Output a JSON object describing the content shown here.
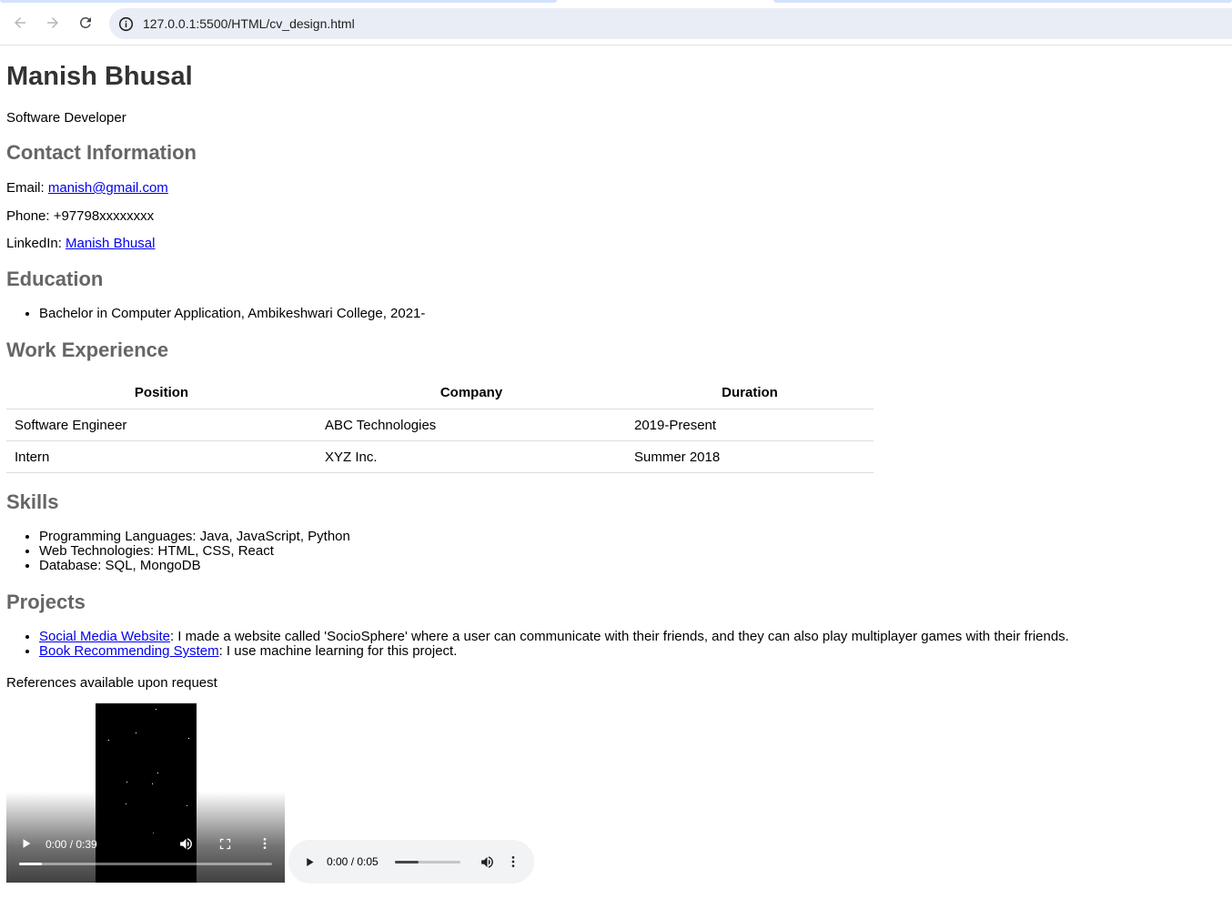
{
  "browser": {
    "url": "127.0.0.1:5500/HTML/cv_design.html",
    "icons": {
      "back": "arrow-left-icon",
      "forward": "arrow-right-icon",
      "reload": "reload-icon",
      "site_info": "info-icon"
    }
  },
  "cv": {
    "name": "Manish Bhusal",
    "title": "Software Developer",
    "contact": {
      "heading": "Contact Information",
      "email_label": "Email: ",
      "email": "manish@gmail.com",
      "phone": "Phone: +97798xxxxxxxx",
      "linkedin_label": "LinkedIn: ",
      "linkedin": "Manish Bhusal"
    },
    "education": {
      "heading": "Education",
      "items": [
        "Bachelor in Computer Application, Ambikeshwari College, 2021-"
      ]
    },
    "work": {
      "heading": "Work Experience",
      "columns": [
        "Position",
        "Company",
        "Duration"
      ],
      "rows": [
        [
          "Software Engineer",
          "ABC Technologies",
          "2019-Present"
        ],
        [
          "Intern",
          "XYZ Inc.",
          "Summer 2018"
        ]
      ]
    },
    "skills": {
      "heading": "Skills",
      "items": [
        "Programming Languages: Java, JavaScript, Python",
        "Web Technologies: HTML, CSS, React",
        "Database: SQL, MongoDB"
      ]
    },
    "projects": {
      "heading": "Projects",
      "items": [
        {
          "link": "Social Media Website",
          "text": ": I made a website called 'SocioSphere' where a user can communicate with their friends, and they can also play multiplayer games with their friends."
        },
        {
          "link": "Book Recommending System",
          "text": ": I use machine learning for this project."
        }
      ]
    },
    "references": "References available upon request"
  },
  "media": {
    "video": {
      "time": "0:00 / 0:39",
      "progress": 0.09
    },
    "audio": {
      "time": "0:00 / 0:05",
      "progress": 0.36
    }
  },
  "colors": {
    "heading": "#333333",
    "section_heading": "#666666",
    "link": "#0000ee"
  }
}
